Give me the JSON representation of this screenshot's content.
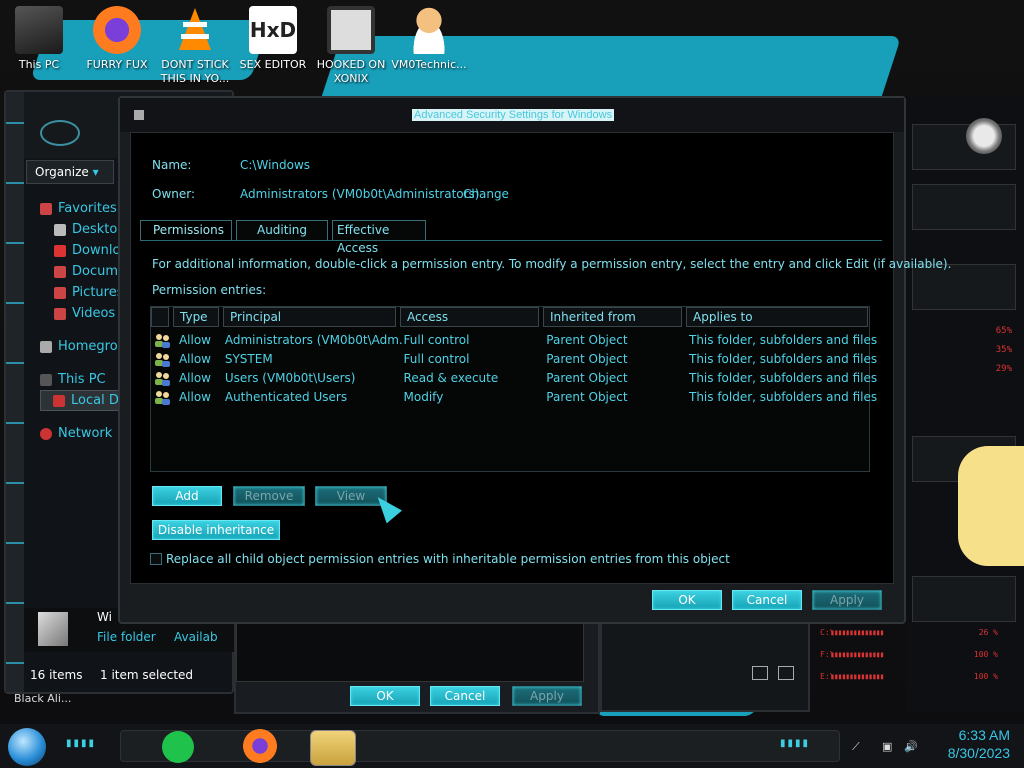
{
  "desktop": {
    "icons": [
      {
        "label": "This PC"
      },
      {
        "label": "FURRY FUX"
      },
      {
        "label": "DONT STICK THIS IN YO..."
      },
      {
        "label": "SEX EDITOR"
      },
      {
        "label": "HOOKED ON XONIX"
      },
      {
        "label": "VM0Technic..."
      }
    ],
    "bottom_left_label": "Black Ali..."
  },
  "explorer": {
    "organize_label": "Organize",
    "nav": [
      {
        "label": "Favorites"
      },
      {
        "label": "Desktop"
      },
      {
        "label": "Downlo"
      },
      {
        "label": "Docum"
      },
      {
        "label": "Pictures"
      },
      {
        "label": "Videos"
      },
      {
        "label": "Homegro"
      },
      {
        "label": "This PC"
      },
      {
        "label": "Local D"
      },
      {
        "label": "Network"
      }
    ],
    "details_name": "Wi",
    "details_type": "File folder",
    "details_avail": "Availab",
    "status_items": "16 items",
    "status_selected": "1 item selected"
  },
  "background_dialog": {
    "ok_label": "OK",
    "cancel_label": "Cancel",
    "apply_label": "Apply"
  },
  "dialog": {
    "title": "Advanced Security Settings for Windows",
    "name_label": "Name:",
    "name_value": "C:\\Windows",
    "owner_label": "Owner:",
    "owner_value": "Administrators (VM0b0t\\Administrators)",
    "change_label": "Change",
    "tabs": [
      {
        "label": "Permissions"
      },
      {
        "label": "Auditing"
      },
      {
        "label": "Effective Access"
      }
    ],
    "info_text": "For additional information, double-click a permission entry. To modify a permission entry, select the entry and click Edit (if available).",
    "entries_label": "Permission entries:",
    "columns": {
      "type": "Type",
      "principal": "Principal",
      "access": "Access",
      "inherited": "Inherited from",
      "applies": "Applies to"
    },
    "rows": [
      {
        "type": "Allow",
        "principal": "Administrators (VM0b0t\\Adm...",
        "access": "Full control",
        "inherited": "Parent Object",
        "applies": "This folder, subfolders and files"
      },
      {
        "type": "Allow",
        "principal": "SYSTEM",
        "access": "Full control",
        "inherited": "Parent Object",
        "applies": "This folder, subfolders and files"
      },
      {
        "type": "Allow",
        "principal": "Users (VM0b0t\\Users)",
        "access": "Read & execute",
        "inherited": "Parent Object",
        "applies": "This folder, subfolders and files"
      },
      {
        "type": "Allow",
        "principal": "Authenticated Users",
        "access": "Modify",
        "inherited": "Parent Object",
        "applies": "This folder, subfolders and files"
      }
    ],
    "add_label": "Add",
    "remove_label": "Remove",
    "view_label": "View",
    "disable_inheritance_label": "Disable inheritance",
    "replace_checkbox_label": "Replace all child object permission entries with inheritable permission entries from this object",
    "ok_label": "OK",
    "cancel_label": "Cancel",
    "apply_label": "Apply"
  },
  "gadget": {
    "meters": [
      {
        "value": "65%"
      },
      {
        "value": "35%"
      },
      {
        "value": "29%"
      }
    ],
    "bottom_meters": [
      {
        "label": "C:\\",
        "value": "26 %"
      },
      {
        "label": "F:\\",
        "value": "100 %"
      },
      {
        "label": "E:\\",
        "value": "100 %"
      }
    ]
  },
  "taskbar": {
    "time": "6:33 AM",
    "date": "8/30/2023"
  },
  "colors": {
    "accent": "#3bcfe0",
    "text": "#4fd2e6",
    "gadget_red": "#dd3333"
  }
}
